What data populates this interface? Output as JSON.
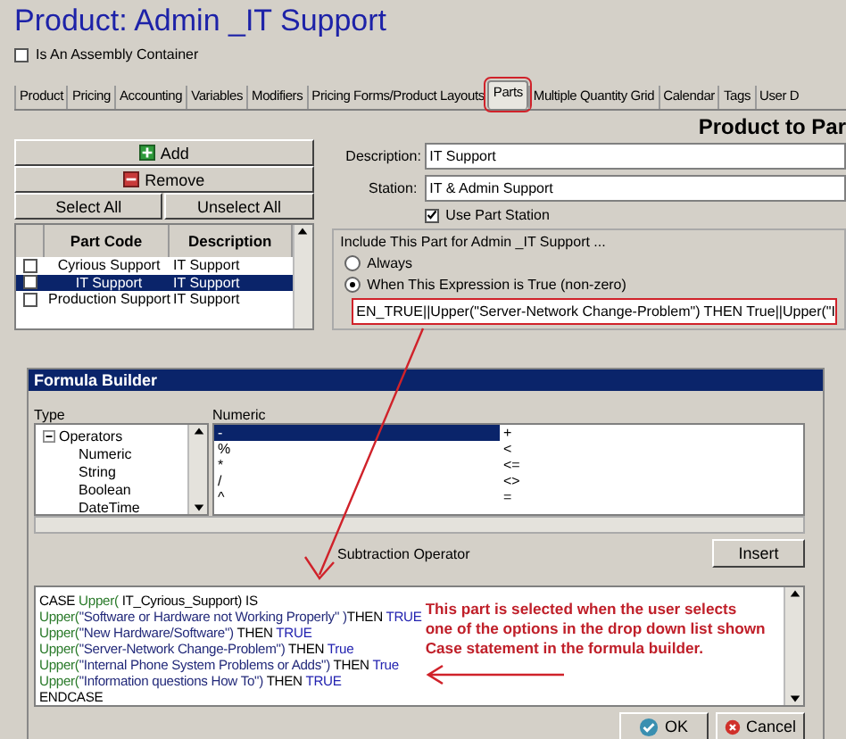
{
  "window": {
    "title": "Product:  Admin _IT Support"
  },
  "assembly_container": {
    "label": "Is An Assembly Container",
    "checked": false
  },
  "tabs": [
    {
      "label": "Product",
      "selected": false
    },
    {
      "label": "Pricing",
      "selected": false
    },
    {
      "label": "Accounting",
      "selected": false
    },
    {
      "label": "Variables",
      "selected": false
    },
    {
      "label": "Modifiers",
      "selected": false
    },
    {
      "label": "Pricing Forms/Product Layouts",
      "selected": false
    },
    {
      "label": "Parts",
      "selected": true
    },
    {
      "label": "Multiple Quantity Grid",
      "selected": false
    },
    {
      "label": "Calendar",
      "selected": false
    },
    {
      "label": "Tags",
      "selected": false
    },
    {
      "label": "User D",
      "selected": false
    }
  ],
  "section_title": "Product to Par",
  "parts_panel": {
    "add_button": "Add",
    "remove_button": "Remove",
    "select_buttons": [
      "Select All",
      "Unselect All"
    ],
    "columns": [
      "Part Code",
      "Description"
    ],
    "rows": [
      {
        "part_code": "Cyrious Support",
        "description": "IT Support",
        "checked": false,
        "selected": false
      },
      {
        "part_code": "IT Support",
        "description": "IT Support",
        "checked": false,
        "selected": true
      },
      {
        "part_code": "Production Support",
        "description": "IT Support",
        "checked": false,
        "selected": false
      }
    ]
  },
  "details": {
    "description": {
      "label": "Description:",
      "value": "IT Support"
    },
    "station": {
      "label": "Station:",
      "value": "IT & Admin Support"
    },
    "use_part_station": {
      "label": "Use Part Station",
      "checked": true
    },
    "include_label": "Include This Part for Admin _IT Support ...",
    "include_options": [
      {
        "label": "Always",
        "selected": false
      },
      {
        "label": "When This Expression is True (non-zero)",
        "selected": true
      }
    ],
    "expression": "EN_TRUE||Upper(\"Server-Network Change-Problem\") THEN True||Upper(\"I"
  },
  "formula_builder": {
    "title": "Formula Builder",
    "type_label": "Type",
    "list_label": "Numeric",
    "tree": [
      {
        "label": "Operators",
        "expanded": true,
        "children": [
          {
            "label": "Numeric"
          },
          {
            "label": "String"
          },
          {
            "label": "Boolean"
          },
          {
            "label": "DateTime"
          }
        ]
      }
    ],
    "operators": [
      {
        "symbol": "-",
        "selected": true
      },
      {
        "symbol": "%",
        "selected": false
      },
      {
        "symbol": "*",
        "selected": false
      },
      {
        "symbol": "/",
        "selected": false
      },
      {
        "symbol": "^",
        "selected": false
      },
      {
        "symbol": "+",
        "selected": false
      },
      {
        "symbol": "<",
        "selected": false
      },
      {
        "symbol": "<=",
        "selected": false
      },
      {
        "symbol": "<>",
        "selected": false
      },
      {
        "symbol": "=",
        "selected": false
      }
    ],
    "operator_description": "Subtraction Operator",
    "insert_button": "Insert",
    "code_lines": [
      [
        {
          "text": "CASE  ",
          "kind": "plain"
        },
        {
          "text": "Upper(",
          "kind": "function"
        },
        {
          "text": " IT_Cyrious_Support) IS",
          "kind": "plain"
        }
      ],
      [
        {
          "text": "Upper(",
          "kind": "function"
        },
        {
          "text": "\"Software or Hardware not Working Properly\" )",
          "kind": "string"
        },
        {
          "text": "THEN ",
          "kind": "plain"
        },
        {
          "text": "TRUE",
          "kind": "keyword"
        }
      ],
      [
        {
          "text": "Upper(",
          "kind": "function"
        },
        {
          "text": "\"New Hardware/Software\") ",
          "kind": "string"
        },
        {
          "text": "THEN ",
          "kind": "plain"
        },
        {
          "text": "TRUE",
          "kind": "keyword"
        }
      ],
      [
        {
          "text": "Upper(",
          "kind": "function"
        },
        {
          "text": "\"Server-Network Change-Problem\") ",
          "kind": "string"
        },
        {
          "text": "THEN ",
          "kind": "plain"
        },
        {
          "text": "True",
          "kind": "keyword"
        }
      ],
      [
        {
          "text": "Upper(",
          "kind": "function"
        },
        {
          "text": "\"Internal Phone System Problems or Adds\") ",
          "kind": "string"
        },
        {
          "text": "THEN ",
          "kind": "plain"
        },
        {
          "text": "True",
          "kind": "keyword"
        }
      ],
      [
        {
          "text": "Upper(",
          "kind": "function"
        },
        {
          "text": "\"Information questions How To\") ",
          "kind": "string"
        },
        {
          "text": "THEN ",
          "kind": "plain"
        },
        {
          "text": "TRUE",
          "kind": "keyword"
        }
      ],
      [
        {
          "text": "ENDCASE",
          "kind": "plain"
        }
      ]
    ],
    "annotation_lines": [
      "This part is selected when the user selects",
      "one of the options in the drop down list shown",
      "Case statement in the formula builder."
    ],
    "buttons": [
      {
        "label": "OK",
        "kind": "ok"
      },
      {
        "label": "Cancel",
        "kind": "cancel"
      }
    ]
  }
}
